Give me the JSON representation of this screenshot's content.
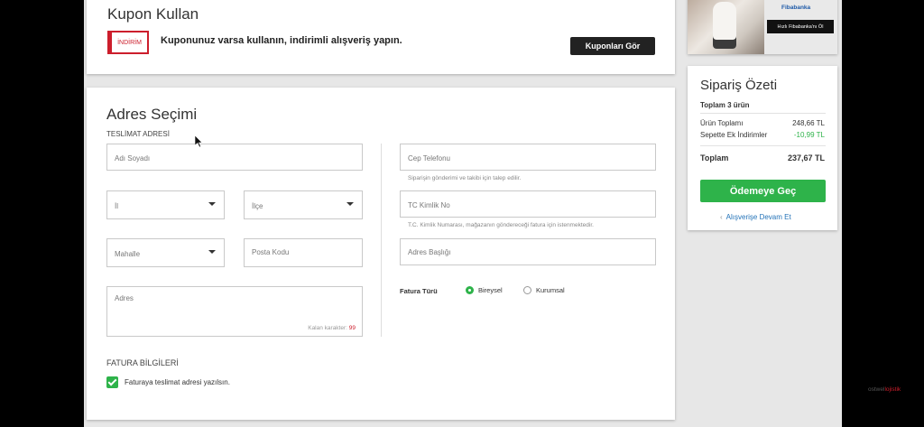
{
  "coupon": {
    "title": "Kupon Kullan",
    "badge": "İNDİRİM",
    "text": "Kuponunuz varsa kullanın, indirimli alışveriş yapın.",
    "button": "Kuponları Gör"
  },
  "address": {
    "title": "Adres Seçimi",
    "section": "TESLİMAT ADRESİ",
    "name_placeholder": "Adı Soyadı",
    "city_placeholder": "İl",
    "district_placeholder": "İlçe",
    "neighborhood_placeholder": "Mahalle",
    "postcode_placeholder": "Posta Kodu",
    "address_placeholder": "Adres",
    "remaining_label": "Kalan karakter:",
    "remaining_count": "99",
    "phone_placeholder": "Cep Telefonu",
    "phone_hint": "Siparişin gönderimi ve takibi için talep edilir.",
    "tc_placeholder": "TC Kimlik No",
    "tc_hint": "T.C. Kimlik Numarası, mağazanın göndereceği fatura için istenmektedir.",
    "address_title_placeholder": "Adres Başlığı",
    "invoice_type_label": "Fatura Türü",
    "invoice_individual": "Bireysel",
    "invoice_corporate": "Kurumsal",
    "invoice_selected": "Bireysel"
  },
  "invoice": {
    "section": "FATURA BİLGİLERİ",
    "same_address": "Faturaya teslimat adresi yazılsın.",
    "same_address_checked": true
  },
  "ad": {
    "bank": "Fibabanka",
    "button": "Hızlı Fibabanka'nı Öl"
  },
  "summary": {
    "title": "Sipariş Özeti",
    "count": "Toplam 3 ürün",
    "subtotal_label": "Ürün Toplamı",
    "subtotal_value": "248,66 TL",
    "discount_label": "Sepette Ek İndirimler",
    "discount_value": "-10,99 TL",
    "total_label": "Toplam",
    "total_value": "237,67 TL",
    "checkout": "Ödemeye Geç",
    "continue": "Alışverişe Devam Et"
  },
  "watermark": {
    "a": "ostwel",
    "b": "lojistik"
  },
  "colors": {
    "green": "#2eb34a",
    "red": "#cc1e2c",
    "dark": "#222222",
    "link": "#2473b8"
  },
  "icons": [
    "chevron-down-icon",
    "check-icon",
    "chevron-left-icon",
    "mouse-cursor-icon"
  ]
}
